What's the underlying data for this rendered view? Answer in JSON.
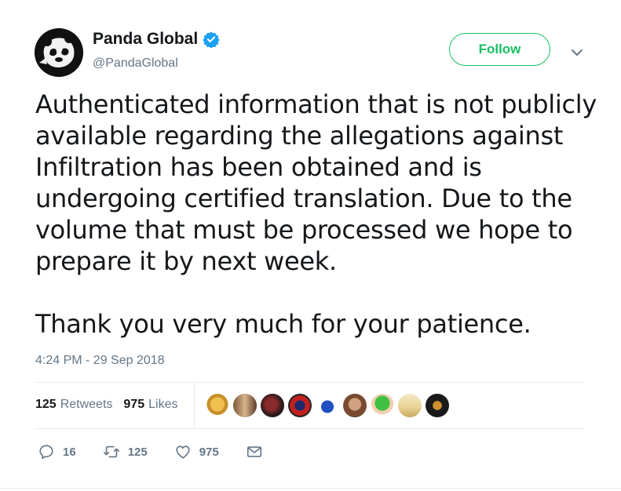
{
  "author": {
    "display_name": "Panda Global",
    "handle": "@PandaGlobal",
    "verified": true,
    "avatar_icon": "panda-logo-icon"
  },
  "follow_label": "Follow",
  "tweet_text": "Authenticated information that is not publicly available regarding the allegations against Infiltration has been obtained and is undergoing certified translation. Due to the volume that must be processed we hope to prepare it by next week.\n\nThank you very much for your patience.",
  "timestamp": "4:24 PM - 29 Sep 2018",
  "stats": {
    "retweets_count": "125",
    "retweets_label": "Retweets",
    "likes_count": "975",
    "likes_label": "Likes"
  },
  "likers_count": 9,
  "actions": {
    "reply_count": "16",
    "retweet_count": "125",
    "like_count": "975"
  },
  "colors": {
    "follow_green": "#17bf63",
    "verified_blue": "#1da1f2",
    "muted_gray": "#657786"
  }
}
